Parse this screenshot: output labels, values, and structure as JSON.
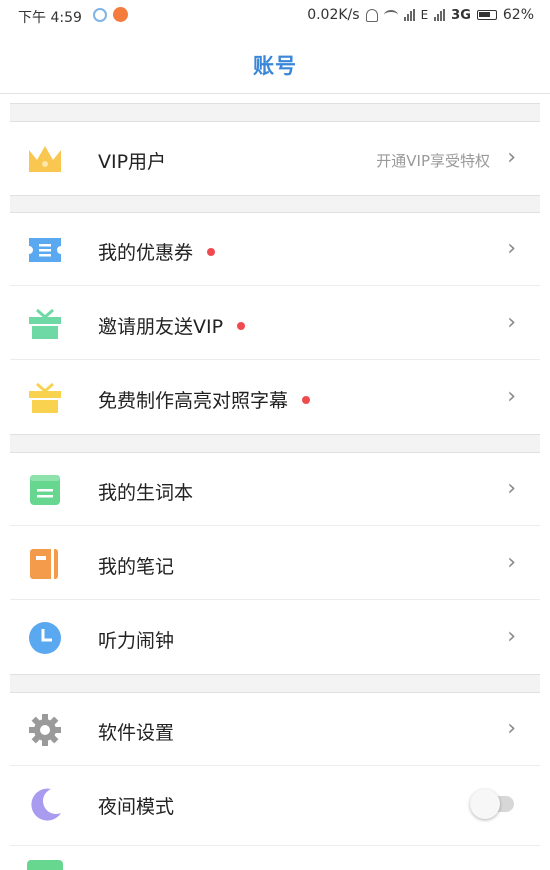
{
  "status_bar": {
    "time": "下午 4:59",
    "network_speed": "0.02K/s",
    "network_type": "3G",
    "battery": "62%"
  },
  "header": {
    "title": "账号"
  },
  "rows": {
    "vip": {
      "label": "VIP用户",
      "hint": "开通VIP享受特权",
      "icon": "crown-icon"
    },
    "coupons": {
      "label": "我的优惠券",
      "icon": "ticket-icon",
      "has_dot": true
    },
    "invite": {
      "label": "邀请朋友送VIP",
      "icon": "gift-icon",
      "has_dot": true
    },
    "subtitles": {
      "label": "免费制作高亮对照字幕",
      "icon": "gift-icon",
      "has_dot": true
    },
    "vocab": {
      "label": "我的生词本",
      "icon": "book-icon"
    },
    "notes": {
      "label": "我的笔记",
      "icon": "notebook-icon"
    },
    "alarm": {
      "label": "听力闹钟",
      "icon": "clock-icon"
    },
    "settings": {
      "label": "软件设置",
      "icon": "gear-icon"
    },
    "night_mode": {
      "label": "夜间模式",
      "icon": "moon-icon",
      "enabled": false
    }
  },
  "chevron": "›",
  "colors": {
    "accent": "#3a86d8",
    "crown": "#f9c74f",
    "ticket": "#5aa9f0",
    "gift_green": "#6fd9a6",
    "gift_yellow": "#f9d24f",
    "book_green": "#67d68f",
    "notebook_orange": "#f39a4b",
    "clock_blue": "#5aa9f0",
    "gear_gray": "#9a9a9a",
    "moon_purple": "#a99cf0",
    "red_dot": "#ef4b4f"
  }
}
